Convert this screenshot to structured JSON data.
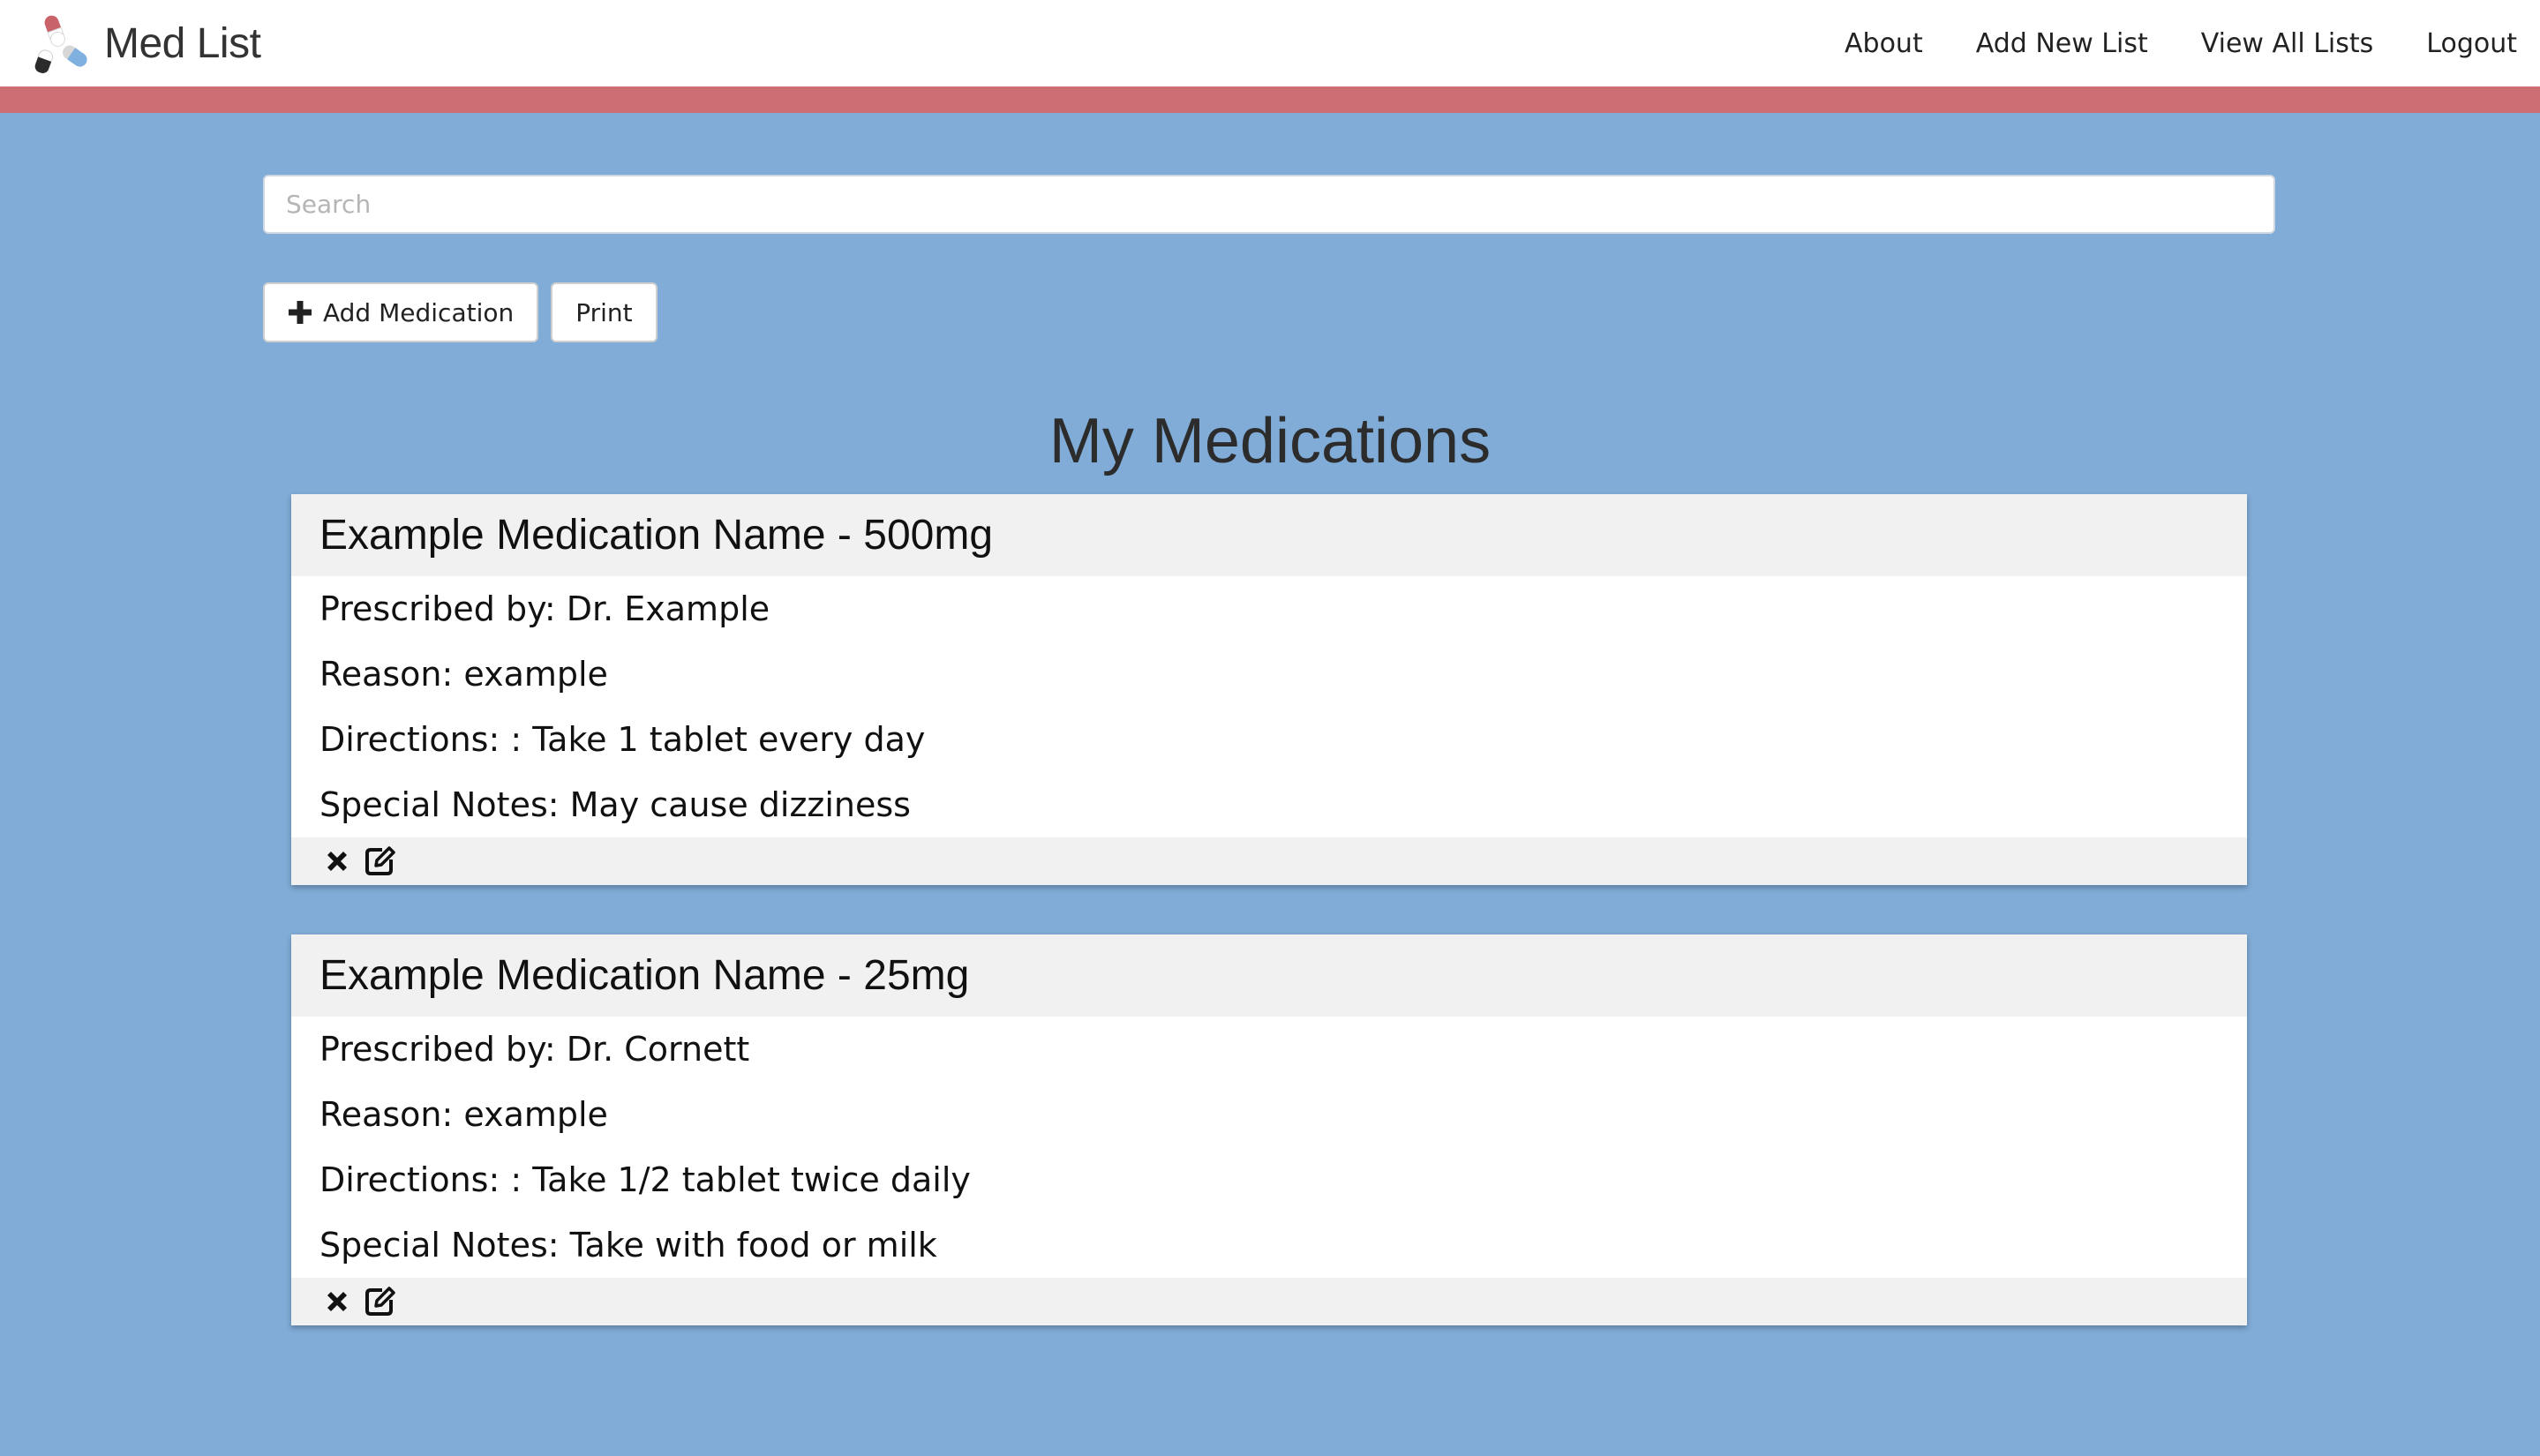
{
  "app": {
    "name": "Med List",
    "logo_icon": "pill-capsules-logo"
  },
  "nav": {
    "links": [
      "About",
      "Add New List",
      "View All Lists",
      "Logout"
    ]
  },
  "colors": {
    "background": "#80acd7",
    "accent_bar": "#cc6e73",
    "navbar": "#ffffff",
    "card_header": "#f1f1f1"
  },
  "search": {
    "placeholder": "Search",
    "value": ""
  },
  "actions": {
    "add_label": "Add Medication",
    "add_icon": "plus-icon",
    "print_label": "Print"
  },
  "page": {
    "title": "My Medications"
  },
  "medications": [
    {
      "title": "Example Medication Name - 500mg",
      "prescribed": "Prescribed by: Dr. Example",
      "reason": "Reason: example",
      "directions": "Directions: : Take 1 tablet every day",
      "notes": "Special Notes: May cause dizziness",
      "actions": [
        "delete-icon",
        "edit-icon"
      ]
    },
    {
      "title": "Example Medication Name - 25mg",
      "prescribed": "Prescribed by: Dr. Cornett",
      "reason": "Reason: example",
      "directions": "Directions: : Take 1/2 tablet twice daily",
      "notes": "Special Notes: Take with food or milk",
      "actions": [
        "delete-icon",
        "edit-icon"
      ]
    }
  ]
}
